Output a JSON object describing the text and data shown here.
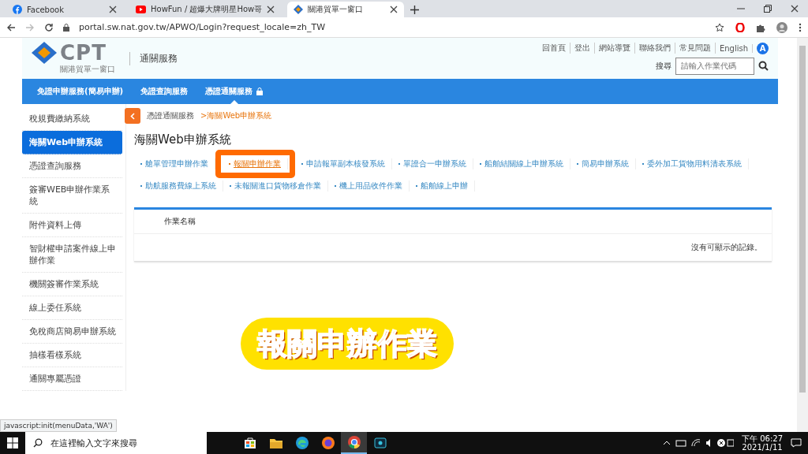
{
  "browser": {
    "tabs": [
      {
        "title": "Facebook",
        "kind": "facebook",
        "selected": false
      },
      {
        "title": "HowFun / 超爆大牌明星How哥",
        "kind": "youtube",
        "selected": false
      },
      {
        "title": "關港貿單一窗口",
        "kind": "portal",
        "selected": true
      }
    ],
    "url": "portal.sw.nat.gov.tw/APWO/Login?request_locale=zh_TW",
    "status": "javascript:init(menuData,'WA')"
  },
  "header": {
    "logo": "CPT",
    "logo_sub": "關港貿單一窗口",
    "service": "通關服務",
    "links": [
      "回首頁",
      "登出",
      "網站導覽",
      "聯絡我們",
      "常見問題",
      "English"
    ],
    "accessibility": "A",
    "search_label": "搜尋",
    "search_placeholder": "請輸入作業代碼"
  },
  "nav": [
    {
      "label": "免證申辦服務(簡易申辦)",
      "selected": false,
      "locked": false
    },
    {
      "label": "免證查詢服務",
      "selected": false,
      "locked": false
    },
    {
      "label": "憑證通關服務",
      "selected": true,
      "locked": true
    }
  ],
  "sidebar": [
    {
      "label": "稅規費繳納系統",
      "selected": false
    },
    {
      "label": "海關Web申辦系統",
      "selected": true
    },
    {
      "label": "憑證查詢服務",
      "selected": false
    },
    {
      "label": "簽審WEB申辦作業系統",
      "selected": false
    },
    {
      "label": "附件資料上傳",
      "selected": false
    },
    {
      "label": "智財權申請案件線上申辦作業",
      "selected": false
    },
    {
      "label": "機關簽審作業系統",
      "selected": false
    },
    {
      "label": "線上委任系統",
      "selected": false
    },
    {
      "label": "免稅商店簡易申辦系統",
      "selected": false
    },
    {
      "label": "抽樣看樣系統",
      "selected": false
    },
    {
      "label": "通關專屬憑證",
      "selected": false
    }
  ],
  "breadcrumb": {
    "parent": "憑證通關服務",
    "current": ">海關Web申辦系統"
  },
  "title": "海關Web申辦系統",
  "links": [
    {
      "label": "艙單管理申辦作業",
      "selected": false
    },
    {
      "label": "報關申辦作業",
      "selected": true
    },
    {
      "label": "申請報單副本核發系統",
      "selected": false
    },
    {
      "label": "單證合一申辦系統",
      "selected": false
    },
    {
      "label": "船舶結關線上申辦系統",
      "selected": false
    },
    {
      "label": "簡易申辦系統",
      "selected": false
    },
    {
      "label": "委外加工貨物用料清表系統",
      "selected": false
    },
    {
      "label": "助航服務費線上系統",
      "selected": false
    },
    {
      "label": "未報關進口貨物移倉作業",
      "selected": false
    },
    {
      "label": "機上用品收件作業",
      "selected": false
    },
    {
      "label": "船舶線上申辦",
      "selected": false
    }
  ],
  "table": {
    "column": "作業名稱",
    "empty": "沒有可顯示的記錄。"
  },
  "caption": "報關申辦作業",
  "taskbar": {
    "search_placeholder": "在這裡輸入文字來搜尋",
    "apps": [
      {
        "kind": "store",
        "selected": false
      },
      {
        "kind": "folder",
        "selected": false
      },
      {
        "kind": "edge",
        "selected": false
      },
      {
        "kind": "firefox",
        "selected": false
      },
      {
        "kind": "chrome",
        "selected": true
      },
      {
        "kind": "recorder",
        "selected": false
      }
    ],
    "time": "下午 06:27",
    "date": "2021/1/11"
  }
}
